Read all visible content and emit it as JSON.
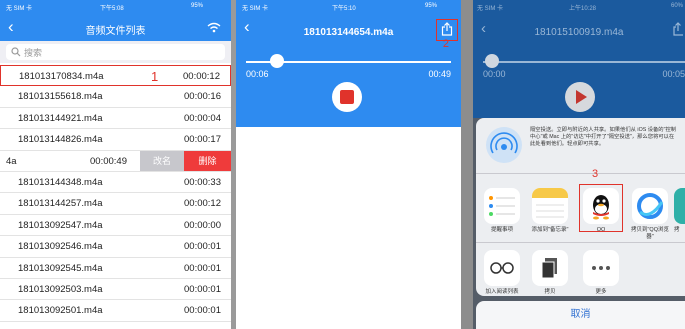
{
  "panel1": {
    "status": {
      "carrier": "无 SIM 卡",
      "time": "下午5:08",
      "battery": "95%"
    },
    "title": "音频文件列表",
    "search_placeholder": "搜索",
    "rows": [
      {
        "name": "181013170834.m4a",
        "duration": "00:00:12"
      },
      {
        "name": "181013155618.m4a",
        "duration": "00:00:16"
      },
      {
        "name": "181013144921.m4a",
        "duration": "00:00:04"
      },
      {
        "name": "181013144826.m4a",
        "duration": "00:00:17"
      },
      {
        "name": "4a",
        "duration": "00:00:49"
      },
      {
        "name": "181013144348.m4a",
        "duration": "00:00:33"
      },
      {
        "name": "181013144257.m4a",
        "duration": "00:00:12"
      },
      {
        "name": "181013092547.m4a",
        "duration": "00:00:00"
      },
      {
        "name": "181013092546.m4a",
        "duration": "00:00:01"
      },
      {
        "name": "181013092545.m4a",
        "duration": "00:00:01"
      },
      {
        "name": "181013092503.m4a",
        "duration": "00:00:01"
      },
      {
        "name": "181013092501.m4a",
        "duration": "00:00:01"
      }
    ],
    "rename_label": "改名",
    "delete_label": "删除",
    "annotation": "1"
  },
  "panel2": {
    "status": {
      "carrier": "无 SIM 卡",
      "time": "下午5:10",
      "battery": "95%"
    },
    "title": "181013144654.m4a",
    "elapsed": "00:06",
    "total": "00:49",
    "progress": 0.12,
    "annotation": "2"
  },
  "panel3": {
    "status": {
      "carrier": "无 SIM 卡",
      "time": "上午10:28",
      "battery": "60%"
    },
    "title": "181015100919.m4a",
    "elapsed": "00:00",
    "total": "00:05",
    "airdrop_text": "隔空投送。立即与附近的人共享。如果他们从 iOS 设备的\"控制中心\"或 Mac 上的\"访达\"中打开了\"隔空投送\"，那么您将可以在此处看到他们。轻点即可共享。",
    "apps": [
      {
        "label": "提醒事项",
        "icon": "reminders-icon"
      },
      {
        "label": "添加到\"备忘录\"",
        "icon": "notes-icon"
      },
      {
        "label": "QQ",
        "icon": "qq-icon"
      },
      {
        "label": "拷贝到\"QQ浏览器\"",
        "icon": "qq-browser-icon"
      },
      {
        "label": "拷",
        "icon": "more-app-icon"
      }
    ],
    "actions": [
      {
        "label": "加入阅读列表",
        "icon": "reading-list-icon"
      },
      {
        "label": "拷贝",
        "icon": "copy-icon"
      },
      {
        "label": "更多",
        "icon": "more-icon"
      }
    ],
    "cancel_label": "取消",
    "annotation": "3"
  },
  "colors": {
    "accent": "#2e8bf0",
    "highlight": "#e0332b",
    "delete": "#ef3b3b"
  }
}
